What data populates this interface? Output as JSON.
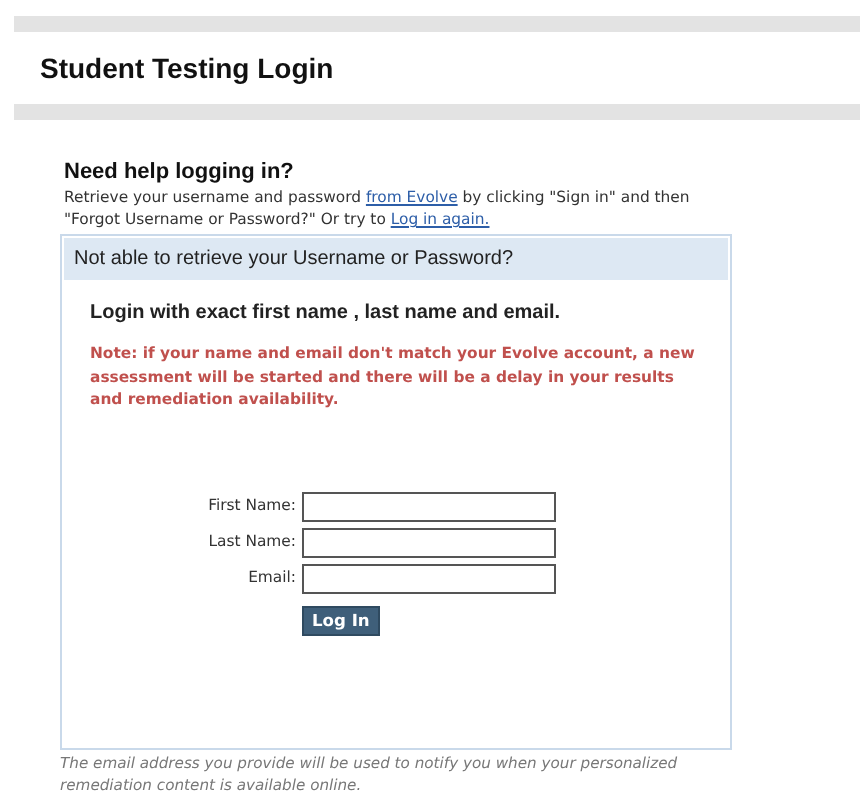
{
  "page_title": "Student Testing Login",
  "help": {
    "heading": "Need help logging in?",
    "parts": [
      {
        "kind": "text",
        "text": "Retrieve your username and password "
      },
      {
        "kind": "link",
        "text": "from Evolve"
      },
      {
        "kind": "text",
        "text": " by clicking \"Sign in\" and then \"Forgot Username or Password?\" Or try to "
      },
      {
        "kind": "link",
        "text": "Log in again."
      }
    ]
  },
  "panel": {
    "header": "Not able to retrieve your Username or Password?",
    "instruction": "Login with exact first name , last name and email.",
    "note": "Note: if your name and email don't match your Evolve account, a new assessment will be started and there will be a delay in your results and remediation availability.",
    "fields": [
      {
        "label": "First Name:"
      },
      {
        "label": "Last Name:"
      },
      {
        "label": "Email:"
      }
    ],
    "button": "Log In"
  },
  "footer": "The email address you provide will be used to notify you when your personalized remediation content is available online."
}
